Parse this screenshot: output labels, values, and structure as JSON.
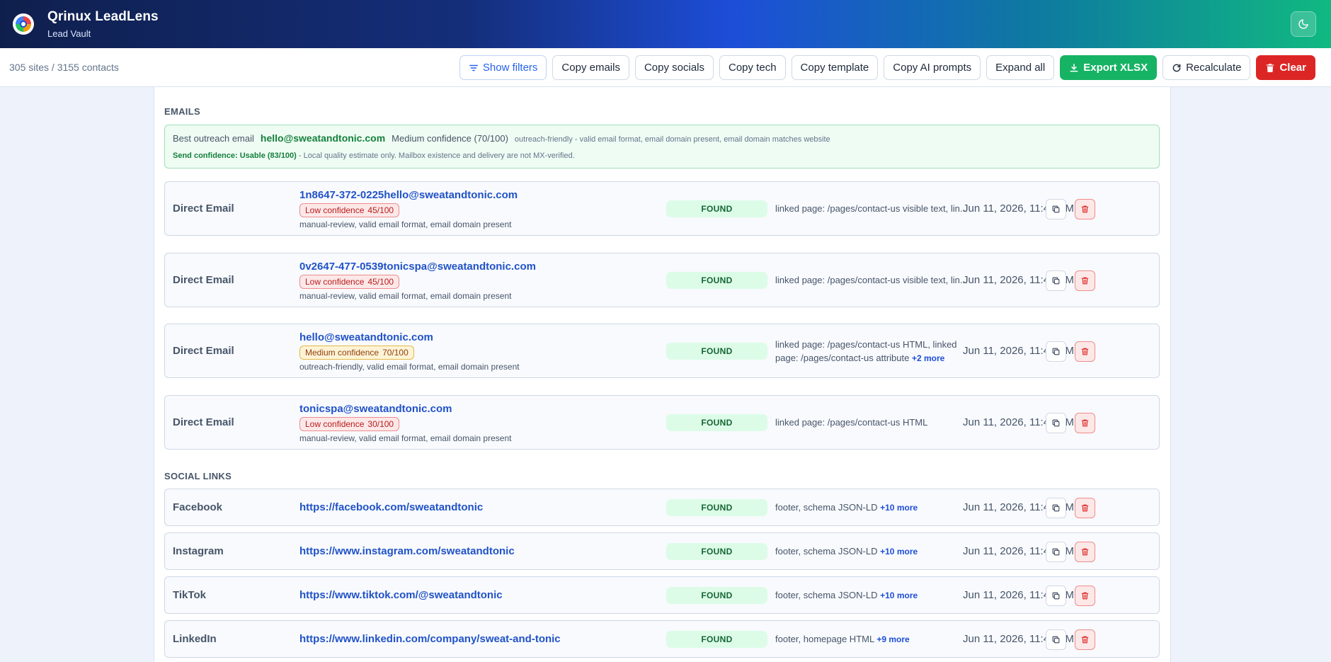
{
  "header": {
    "brand_name": "Qrinux LeadLens",
    "brand_sub": "Lead Vault",
    "theme_icon": "moon-icon"
  },
  "toolbar": {
    "summary": "305 sites / 3155 contacts",
    "show_filters": "Show filters",
    "copy_emails": "Copy emails",
    "copy_socials": "Copy socials",
    "copy_tech": "Copy tech",
    "copy_template": "Copy template",
    "copy_ai_prompts": "Copy AI prompts",
    "expand_all": "Expand all",
    "export_xlsx": "Export XLSX",
    "recalculate": "Recalculate",
    "clear": "Clear"
  },
  "colors": {
    "accent": "#2563eb",
    "export": "#16b364",
    "clear": "#dc2626",
    "found": "#dcfce7"
  },
  "emails_section": {
    "title": "EMAILS",
    "best": {
      "label": "Best outreach email",
      "email": "hello@sweatandtonic.com",
      "confidence": "Medium confidence (70/100)",
      "reason": "outreach-friendly - valid email format, email domain present, email domain matches website",
      "send_confidence": "Send confidence: Usable (83/100)",
      "send_note": " - Local quality estimate only. Mailbox existence and delivery are not MX-verified."
    },
    "rows": [
      {
        "type": "Direct Email",
        "value": "1n8647-372-0225hello@sweatandtonic.com",
        "conf_label": "Low confidence",
        "conf_score": "45/100",
        "reason": "manual-review, valid email format, email domain present",
        "status": "FOUND",
        "source": "linked page: /pages/contact-us visible text, lin...",
        "more": "",
        "date": "Jun 11, 2026, 11:40 PM"
      },
      {
        "type": "Direct Email",
        "value": "0v2647-477-0539tonicspa@sweatandtonic.com",
        "conf_label": "Low confidence",
        "conf_score": "45/100",
        "reason": "manual-review, valid email format, email domain present",
        "status": "FOUND",
        "source": "linked page: /pages/contact-us visible text, lin...",
        "more": "",
        "date": "Jun 11, 2026, 11:40 PM"
      },
      {
        "type": "Direct Email",
        "value": "hello@sweatandtonic.com",
        "conf_label": "Medium confidence",
        "conf_score": "70/100",
        "reason": "outreach-friendly, valid email format, email domain present",
        "status": "FOUND",
        "source": "linked page: /pages/contact-us HTML, linked page: /pages/contact-us attribute",
        "more": "+2 more",
        "date": "Jun 11, 2026, 11:40 PM"
      },
      {
        "type": "Direct Email",
        "value": "tonicspa@sweatandtonic.com",
        "conf_label": "Low confidence",
        "conf_score": "30/100",
        "reason": "manual-review, valid email format, email domain present",
        "status": "FOUND",
        "source": "linked page: /pages/contact-us HTML",
        "more": "",
        "date": "Jun 11, 2026, 11:40 PM"
      }
    ]
  },
  "social_section": {
    "title": "SOCIAL LINKS",
    "rows": [
      {
        "type": "Facebook",
        "value": "https://facebook.com/sweatandtonic",
        "status": "FOUND",
        "source": "footer, schema JSON-LD",
        "more": "+10 more",
        "date": "Jun 11, 2026, 11:40 PM"
      },
      {
        "type": "Instagram",
        "value": "https://www.instagram.com/sweatandtonic",
        "status": "FOUND",
        "source": "footer, schema JSON-LD",
        "more": "+10 more",
        "date": "Jun 11, 2026, 11:40 PM"
      },
      {
        "type": "TikTok",
        "value": "https://www.tiktok.com/@sweatandtonic",
        "status": "FOUND",
        "source": "footer, schema JSON-LD",
        "more": "+10 more",
        "date": "Jun 11, 2026, 11:40 PM"
      },
      {
        "type": "LinkedIn",
        "value": "https://www.linkedin.com/company/sweat-and-tonic",
        "status": "FOUND",
        "source": "footer, homepage HTML",
        "more": "+9 more",
        "date": "Jun 11, 2026, 11:40 PM"
      }
    ]
  }
}
